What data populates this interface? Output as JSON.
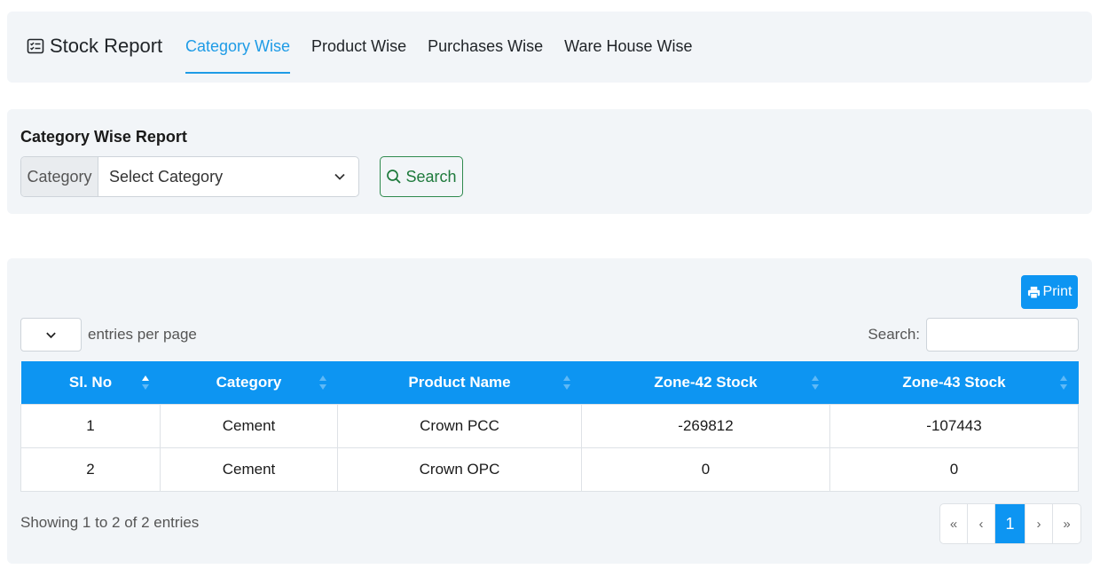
{
  "header": {
    "title": "Stock Report",
    "title_icon": "list-alt-icon",
    "tabs": [
      {
        "label": "Category Wise",
        "active": true
      },
      {
        "label": "Product Wise",
        "active": false
      },
      {
        "label": "Purchases Wise",
        "active": false
      },
      {
        "label": "Ware House Wise",
        "active": false
      }
    ]
  },
  "filter": {
    "title": "Category Wise Report",
    "category_label": "Category",
    "category_select_value": "Select Category",
    "search_button_label": "Search"
  },
  "report": {
    "print_button_label": "Print",
    "entries_per_page_value": "",
    "entries_per_page_label": "entries per page",
    "search_label": "Search:",
    "search_value": "",
    "columns": [
      "Sl. No",
      "Category",
      "Product Name",
      "Zone-42 Stock",
      "Zone-43 Stock"
    ],
    "rows": [
      [
        "1",
        "Cement",
        "Crown PCC",
        "-269812",
        "-107443"
      ],
      [
        "2",
        "Cement",
        "Crown OPC",
        "0",
        "0"
      ]
    ],
    "info_text": "Showing 1 to 2 of 2 entries",
    "pagination": {
      "first": "«",
      "prev": "‹",
      "current": "1",
      "next": "›",
      "last": "»"
    }
  },
  "colors": {
    "accent": "#0d95f2",
    "active_tab": "#1e9be6",
    "search_button": "#1e7a3c",
    "card_bg": "#f2f5f8"
  }
}
